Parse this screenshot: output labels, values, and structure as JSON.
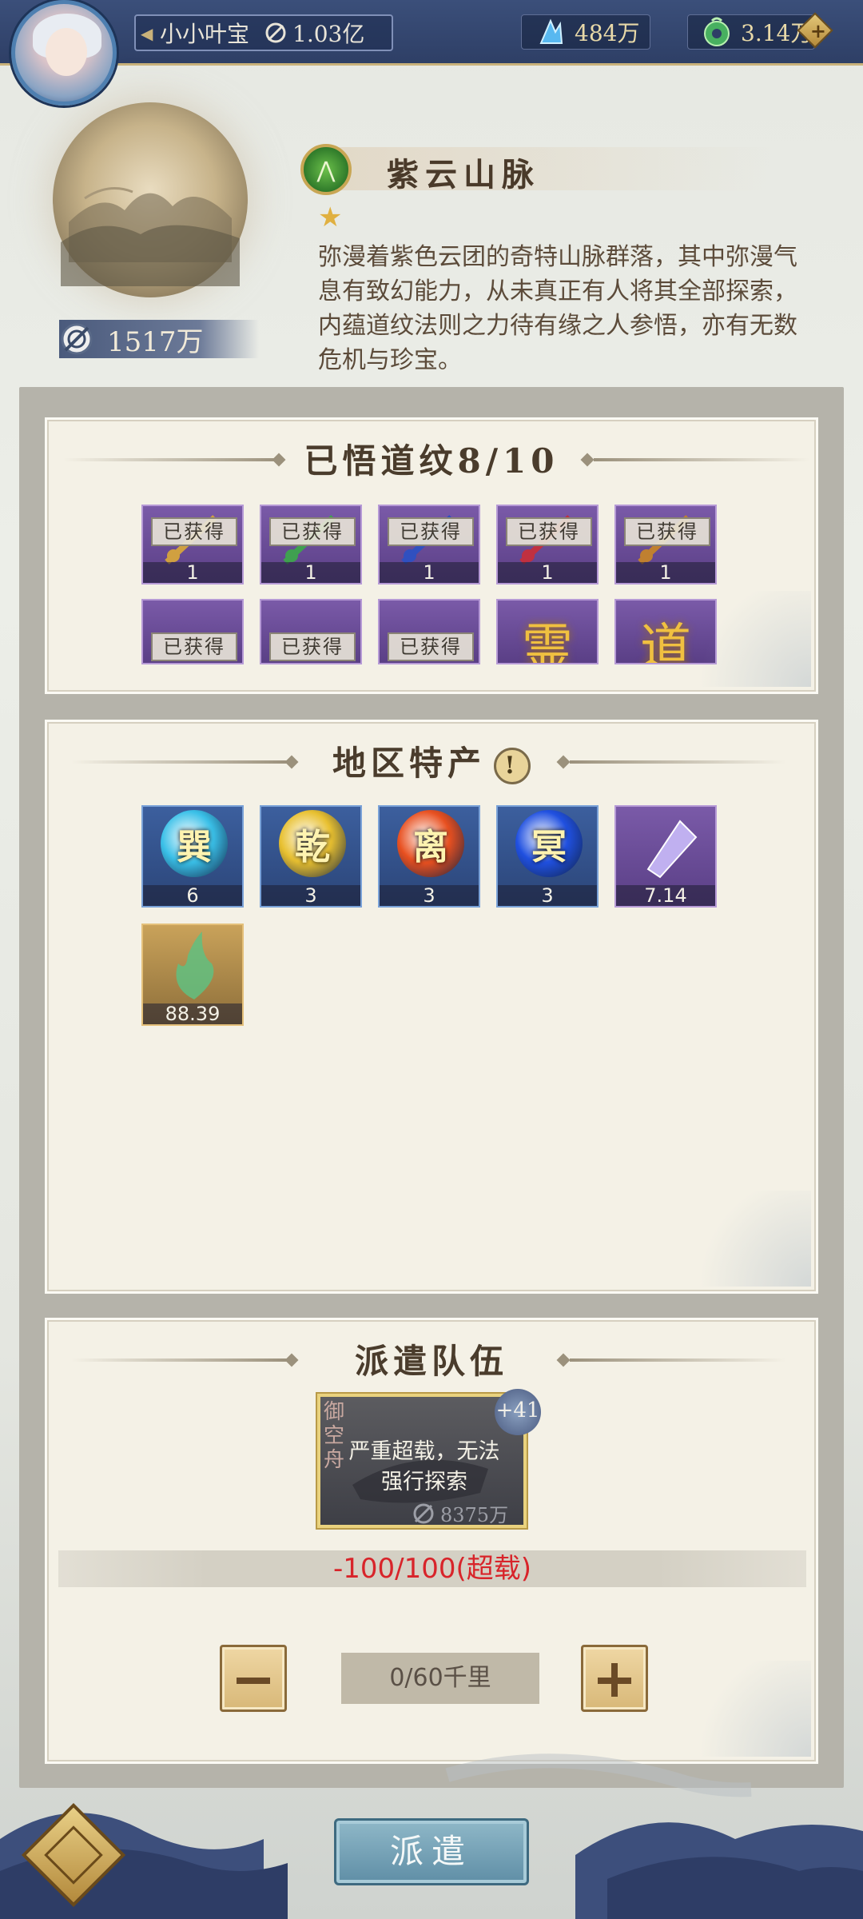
{
  "player": {
    "name": "小小叶宝",
    "power": "1.03亿"
  },
  "resources": [
    {
      "icon": "crystal-icon",
      "value": "484万"
    },
    {
      "icon": "jade-coin-icon",
      "value": "3.14万"
    }
  ],
  "region": {
    "title": "紫云山脉",
    "stars": "★",
    "power": "1517万",
    "description": "弥漫着紫色云团的奇特山脉群落，其中弥漫气息有致幻能力，从未真正有人将其全部探索，内蕴道纹法则之力待有缘之人参悟，亦有无数危机与珍宝。"
  },
  "dao_panel": {
    "title": "已悟道纹8/10",
    "acquired_label": "已获得",
    "row1": [
      {
        "qty": "1",
        "color": "#d0a040"
      },
      {
        "qty": "1",
        "color": "#3fa050"
      },
      {
        "qty": "1",
        "color": "#3050c0"
      },
      {
        "qty": "1",
        "color": "#c03040"
      },
      {
        "qty": "1",
        "color": "#c08030"
      }
    ],
    "row2": [
      {
        "char": "",
        "acquired": true
      },
      {
        "char": "",
        "acquired": true
      },
      {
        "char": "",
        "acquired": true
      },
      {
        "char": "霊",
        "acquired": false
      },
      {
        "char": "道",
        "acquired": false
      }
    ]
  },
  "specialty_panel": {
    "title": "地区特产",
    "warn_symbol": "!",
    "items": [
      {
        "glyph": "巽",
        "qty": "6",
        "kind": "blue",
        "orb": "#3ac0e8"
      },
      {
        "glyph": "乾",
        "qty": "3",
        "kind": "blue",
        "orb": "#e8c030"
      },
      {
        "glyph": "离",
        "qty": "3",
        "kind": "blue",
        "orb": "#e85020"
      },
      {
        "glyph": "冥",
        "qty": "3",
        "kind": "blue",
        "orb": "#2050e0"
      },
      {
        "glyph": "",
        "qty": "7.14",
        "kind": "purple",
        "orb": "#c0b0f0"
      },
      {
        "glyph": "",
        "qty": "88.39",
        "kind": "gold",
        "orb": "#60c080"
      }
    ]
  },
  "dispatch_panel": {
    "title": "派遣队伍",
    "ship_name": "御空舟",
    "ship_bonus": "+41",
    "ship_message": "严重超载，无法强行探索",
    "ship_power": "8375万",
    "load": "-100/100",
    "load_status": "(超载)",
    "distance": "0/60千里"
  },
  "bottom": {
    "dispatch_label": "派遣"
  }
}
